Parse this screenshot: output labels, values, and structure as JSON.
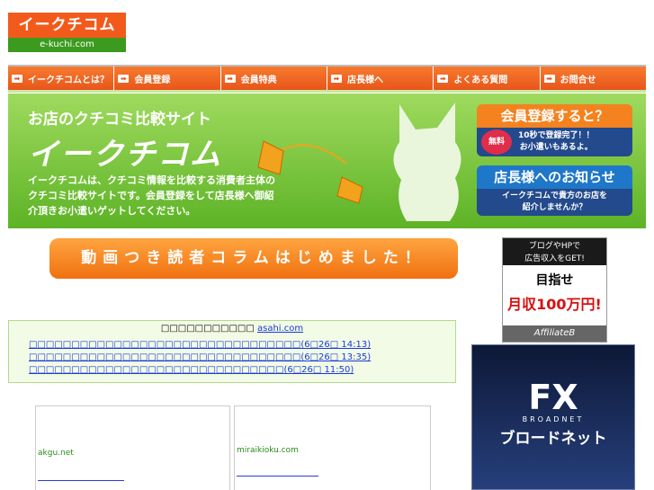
{
  "logo": {
    "main": "イークチコム",
    "domain": "e-kuchi.com"
  },
  "nav": {
    "items": [
      "イークチコムとは？",
      "会員登録",
      "会員特典",
      "店長様へ",
      "よくある質問",
      "お問合せ"
    ],
    "arrow": "➡"
  },
  "banner": {
    "title": "お店のクチコミ比較サイト",
    "brand": "イークチコム",
    "description": "イークチコムは、クチコミ情報を比較する消費者主体のクチコミ比較サイトです。会員登録をして店長様へ御紹介頂きお小遣いゲットしてください。",
    "member_panel": {
      "heading": "会員登録すると？",
      "badge": "無料",
      "line1": "10秒で登録完了！！",
      "line2": "お小遣いもあるよ。"
    },
    "shop_panel": {
      "heading": "店長様へのお知らせ",
      "line1": "イークチコムで貴方のお店を",
      "line2": "紹介しませんか？"
    }
  },
  "column_banner": "動画つき読者コラムはじめました！",
  "ad_affiliate": {
    "top1": "ブログやHPで",
    "top2": "広告収入をGET!",
    "main": "目指せ",
    "amount": "月収100万円!",
    "brand": "AffiliateB"
  },
  "news": {
    "heading": "□□□□□□□□□□□",
    "source": "asahi.com",
    "items": [
      "□□□□□□□□□□□□□□□□□□□□□□□□□□□□□□□□(6□26□ 14:13)",
      "□□□□□□□□□□□□□□□□□□□□□□□□□□□□□□□□(6□26□ 13:35)",
      "□□□□□□□□□□□□□□□□□□□□□□□□□□□□□□(6□26□ 11:50)"
    ]
  },
  "ad_fx": {
    "main": "FX",
    "sub": "BROADNET",
    "kana": "ブロードネット"
  },
  "cards": [
    {
      "title": "akgu.net"
    },
    {
      "title": "miraikioku.com"
    }
  ],
  "colors": {
    "orange": "#f25a1c",
    "green": "#5db326",
    "link": "#1a3ad6"
  }
}
